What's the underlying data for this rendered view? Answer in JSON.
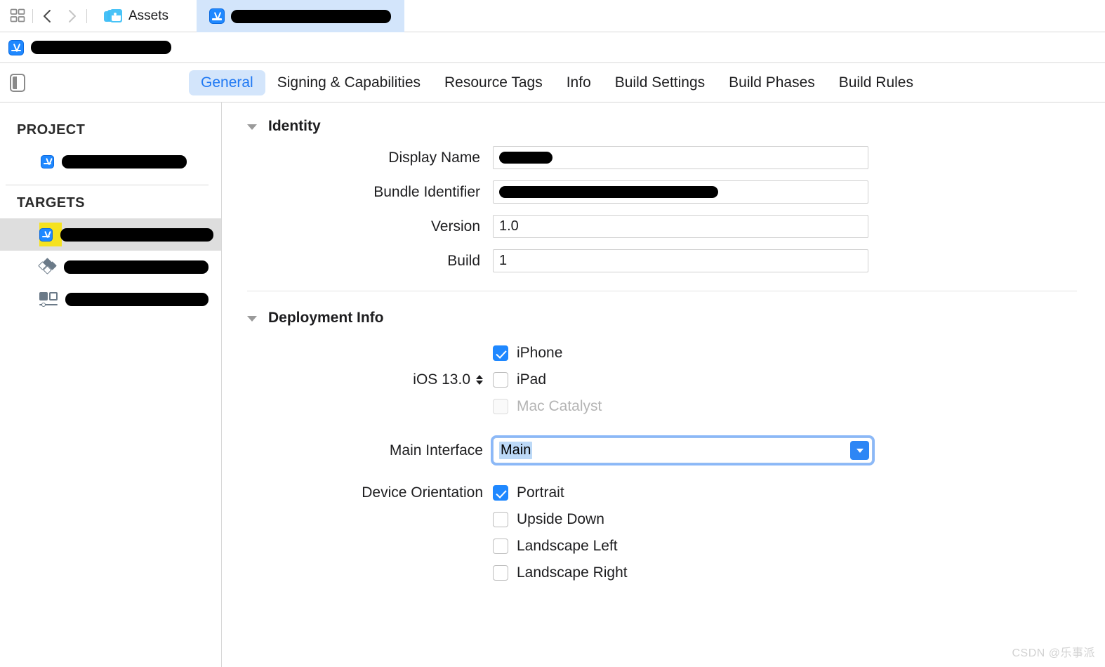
{
  "toolbar": {
    "grid_icon": "multiple-windows-icon",
    "back_icon": "chevron-left-icon",
    "forward_icon": "chevron-right-icon",
    "tabs": [
      {
        "label": "Assets",
        "icon": "assets-photo-stack-icon",
        "active": false
      },
      {
        "label": "",
        "icon": "xcode-project-icon",
        "active": true,
        "redacted": true,
        "redact_width": 228
      }
    ]
  },
  "breadcrumb": {
    "icon": "xcode-project-icon",
    "label": "",
    "redacted": true,
    "redact_width": 200
  },
  "editor": {
    "sidebar_toggle_icon": "sidebar-toggle-icon",
    "tabs": [
      {
        "label": "General",
        "active": true
      },
      {
        "label": "Signing & Capabilities",
        "active": false
      },
      {
        "label": "Resource Tags",
        "active": false
      },
      {
        "label": "Info",
        "active": false
      },
      {
        "label": "Build Settings",
        "active": false
      },
      {
        "label": "Build Phases",
        "active": false
      },
      {
        "label": "Build Rules",
        "active": false
      }
    ]
  },
  "sidebar": {
    "project_header": "PROJECT",
    "targets_header": "TARGETS",
    "project_items": [
      {
        "icon": "xcode-project-icon",
        "label": "",
        "redacted": true,
        "redact_width": 178
      }
    ],
    "target_items": [
      {
        "icon": "app-target-icon",
        "label": "",
        "redacted": true,
        "redact_width": 218,
        "selected": true,
        "highlight": "yellow"
      },
      {
        "icon": "unit-test-diamond-icon",
        "label": "",
        "redacted": true,
        "redact_width": 206,
        "selected": false
      },
      {
        "icon": "ui-test-icon",
        "label": "",
        "redacted": true,
        "redact_width": 204,
        "selected": false
      }
    ]
  },
  "main": {
    "identity": {
      "title": "Identity",
      "collapsed": false,
      "fields": [
        {
          "label": "Display Name",
          "value": "",
          "redacted": true,
          "redact_width": 76
        },
        {
          "label": "Bundle Identifier",
          "value": "",
          "redacted": true,
          "redact_width": 312
        },
        {
          "label": "Version",
          "value": "1.0",
          "redacted": false
        },
        {
          "label": "Build",
          "value": "1",
          "redacted": false
        }
      ]
    },
    "deployment": {
      "title": "Deployment Info",
      "collapsed": false,
      "deployment_target": {
        "label": "iOS 13.0",
        "stepper": "stepper-up-down-icon"
      },
      "devices": [
        {
          "label": "iPhone",
          "checked": true,
          "disabled": false
        },
        {
          "label": "iPad",
          "checked": false,
          "disabled": false
        },
        {
          "label": "Mac Catalyst",
          "checked": false,
          "disabled": true
        }
      ],
      "main_interface": {
        "label": "Main Interface",
        "value": "Main",
        "focused": true,
        "selected_text": true,
        "dropdown_icon": "chevron-down-icon"
      },
      "device_orientation": {
        "label": "Device Orientation",
        "options": [
          {
            "label": "Portrait",
            "checked": true
          },
          {
            "label": "Upside Down",
            "checked": false
          },
          {
            "label": "Landscape Left",
            "checked": false
          },
          {
            "label": "Landscape Right",
            "checked": false
          }
        ]
      }
    }
  },
  "watermark": "CSDN @乐事派",
  "colors": {
    "accent_blue": "#2079f3",
    "checkbox_blue": "#1f88ff",
    "active_tab_bg": "#d3e5fb",
    "selected_row_bg": "#dedede",
    "highlight_yellow": "#f5e21f"
  }
}
